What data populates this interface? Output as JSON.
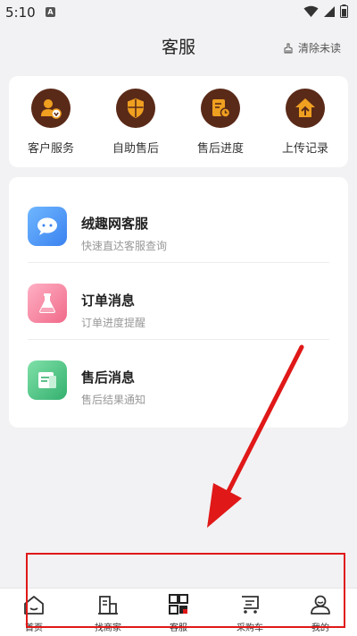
{
  "status_bar": {
    "time": "5:10",
    "notification_letter": "A"
  },
  "header": {
    "title": "客服",
    "clear_unread": "清除未读"
  },
  "quick_actions": [
    {
      "label": "客户服务",
      "icon": "customer-service-icon"
    },
    {
      "label": "自助售后",
      "icon": "shield-icon"
    },
    {
      "label": "售后进度",
      "icon": "progress-doc-icon"
    },
    {
      "label": "上传记录",
      "icon": "upload-icon"
    }
  ],
  "messages": [
    {
      "title": "绒趣网客服",
      "subtitle": "快速直达客服查询",
      "icon": "chat-bubble-icon",
      "color": "#4a90f2"
    },
    {
      "title": "订单消息",
      "subtitle": "订单进度提醒",
      "icon": "flask-icon",
      "color": "#f06a8a"
    },
    {
      "title": "售后消息",
      "subtitle": "售后结果通知",
      "icon": "note-icon",
      "color": "#3cc07a"
    }
  ],
  "tabbar": [
    {
      "label": "首页",
      "icon": "home-icon"
    },
    {
      "label": "找商家",
      "icon": "store-icon"
    },
    {
      "label": "客服",
      "icon": "grid-icon",
      "active": true
    },
    {
      "label": "采购车",
      "icon": "cart-icon"
    },
    {
      "label": "我的",
      "icon": "profile-icon"
    }
  ],
  "colors": {
    "brand_dark": "#5a2a18",
    "brand_accent": "#f0a020",
    "annotation_red": "#e01818"
  }
}
